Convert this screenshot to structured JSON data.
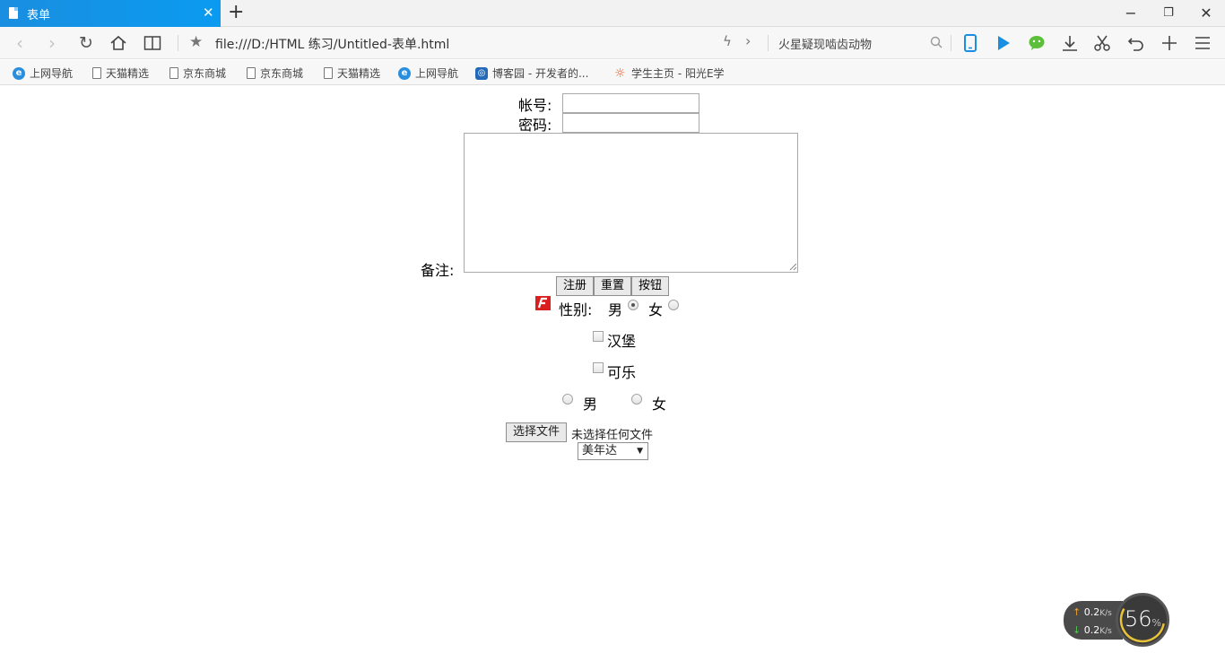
{
  "tab": {
    "title": "表单"
  },
  "address": {
    "url": "file:///D:/HTML 练习/Untitled-表单.html",
    "search_text": "火星疑现啮齿动物"
  },
  "bookmarks": [
    {
      "label": "上网导航",
      "icon": "ie-icon"
    },
    {
      "label": "天猫精选",
      "icon": "page-icon"
    },
    {
      "label": "京东商城",
      "icon": "page-icon"
    },
    {
      "label": "京东商城",
      "icon": "page-icon"
    },
    {
      "label": "天猫精选",
      "icon": "page-icon"
    },
    {
      "label": "上网导航",
      "icon": "ie-icon"
    },
    {
      "label": "博客园 - 开发者的...",
      "icon": "cnblogs-icon"
    },
    {
      "label": "学生主页 - 阳光E学",
      "icon": "sun-icon"
    }
  ],
  "form": {
    "account_label": "帐号:",
    "password_label": "密码:",
    "note_label": "备注:",
    "buttons": {
      "register": "注册",
      "reset": "重置",
      "button": "按钮"
    },
    "gender_label": "性别:",
    "gender_male": "男",
    "gender_female": "女",
    "check_burger": "汉堡",
    "check_cola": "可乐",
    "gender2_male": "男",
    "gender2_female": "女",
    "file_button": "选择文件",
    "file_status": "未选择任何文件",
    "select_value": "美年达"
  },
  "speed_widget": {
    "up": "0.2",
    "down": "0.2",
    "unit": "K/s",
    "percent": "56",
    "percent_sign": "%"
  }
}
